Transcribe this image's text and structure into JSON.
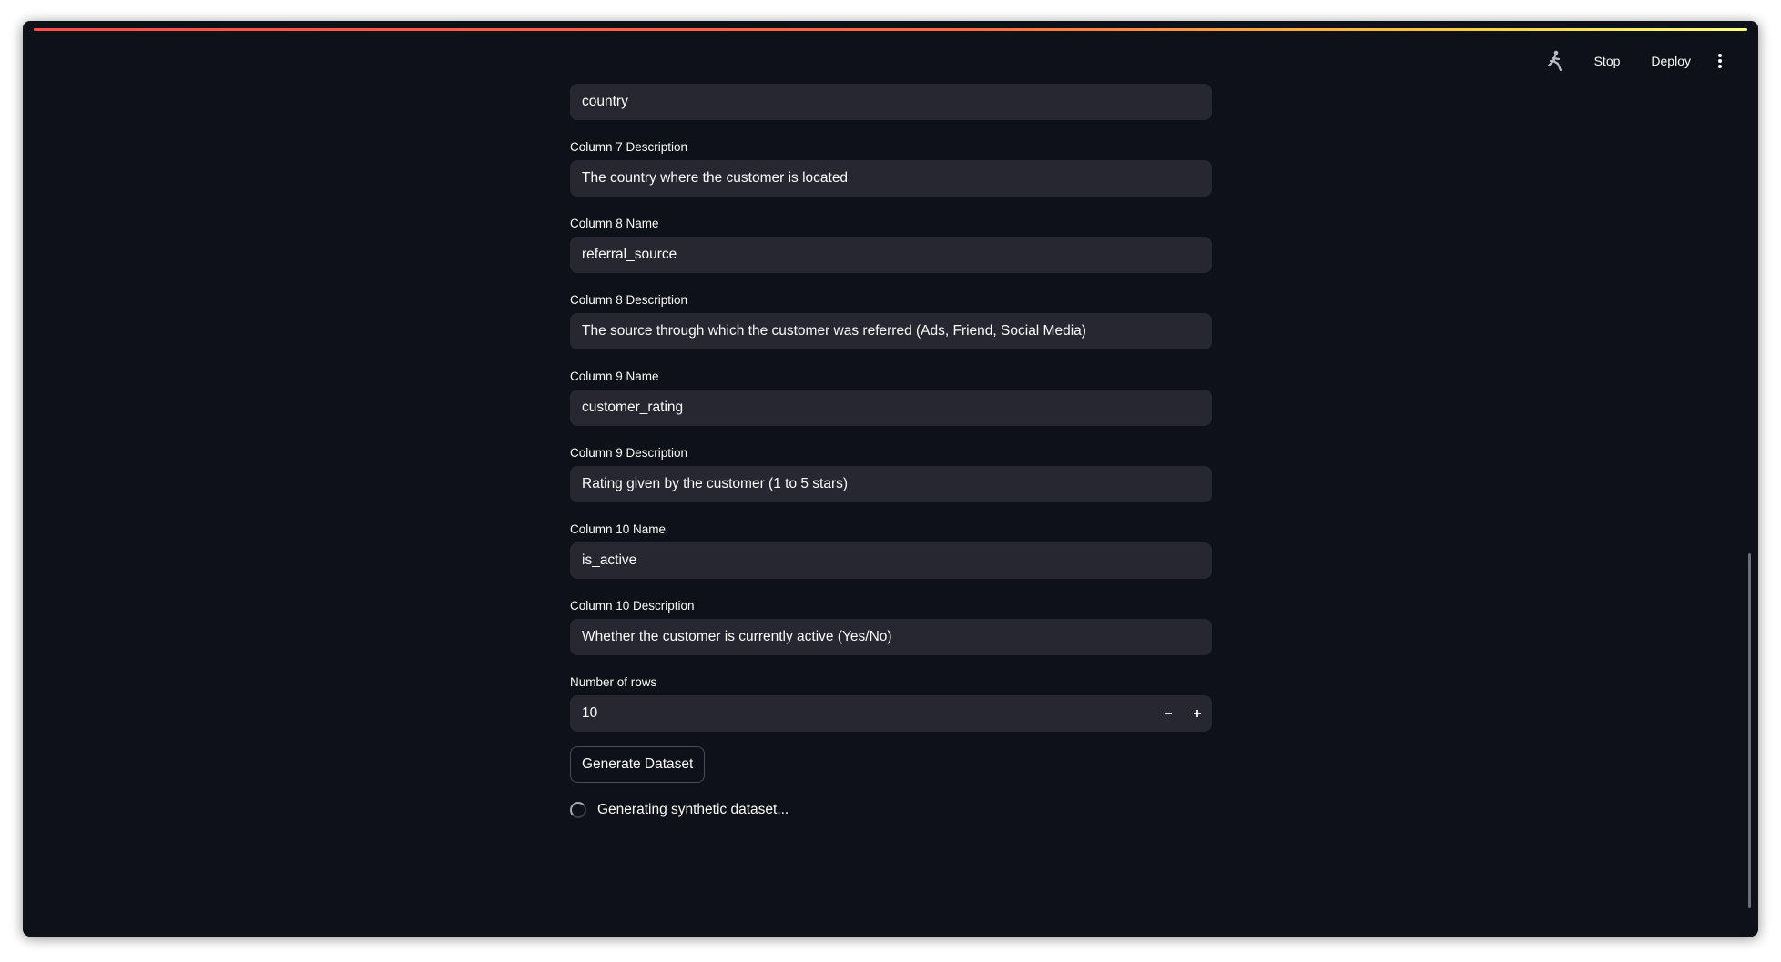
{
  "toolbar": {
    "running_icon": "running-man-icon",
    "stop_label": "Stop",
    "deploy_label": "Deploy",
    "menu_icon": "vertical-ellipsis-icon"
  },
  "form": {
    "top_value": "country",
    "fields": [
      {
        "label": "Column 7 Description",
        "value": "The country where the customer is located"
      },
      {
        "label": "Column 8 Name",
        "value": "referral_source"
      },
      {
        "label": "Column 8 Description",
        "value": "The source through which the customer was referred (Ads, Friend, Social Media)"
      },
      {
        "label": "Column 9 Name",
        "value": "customer_rating"
      },
      {
        "label": "Column 9 Description",
        "value": "Rating given by the customer (1 to 5 stars)"
      },
      {
        "label": "Column 10 Name",
        "value": "is_active"
      },
      {
        "label": "Column 10 Description",
        "value": "Whether the customer is currently active (Yes/No)"
      }
    ],
    "rows": {
      "label": "Number of rows",
      "value": "10",
      "minus_icon": "minus-icon",
      "plus_icon": "plus-icon"
    },
    "generate_label": "Generate Dataset",
    "status_text": "Generating synthetic dataset..."
  },
  "colors": {
    "background": "#0e1117",
    "input_bg": "#262730",
    "text": "#fafafa",
    "accent_red": "#ff4b4b",
    "accent_yellow": "#fffd80"
  }
}
